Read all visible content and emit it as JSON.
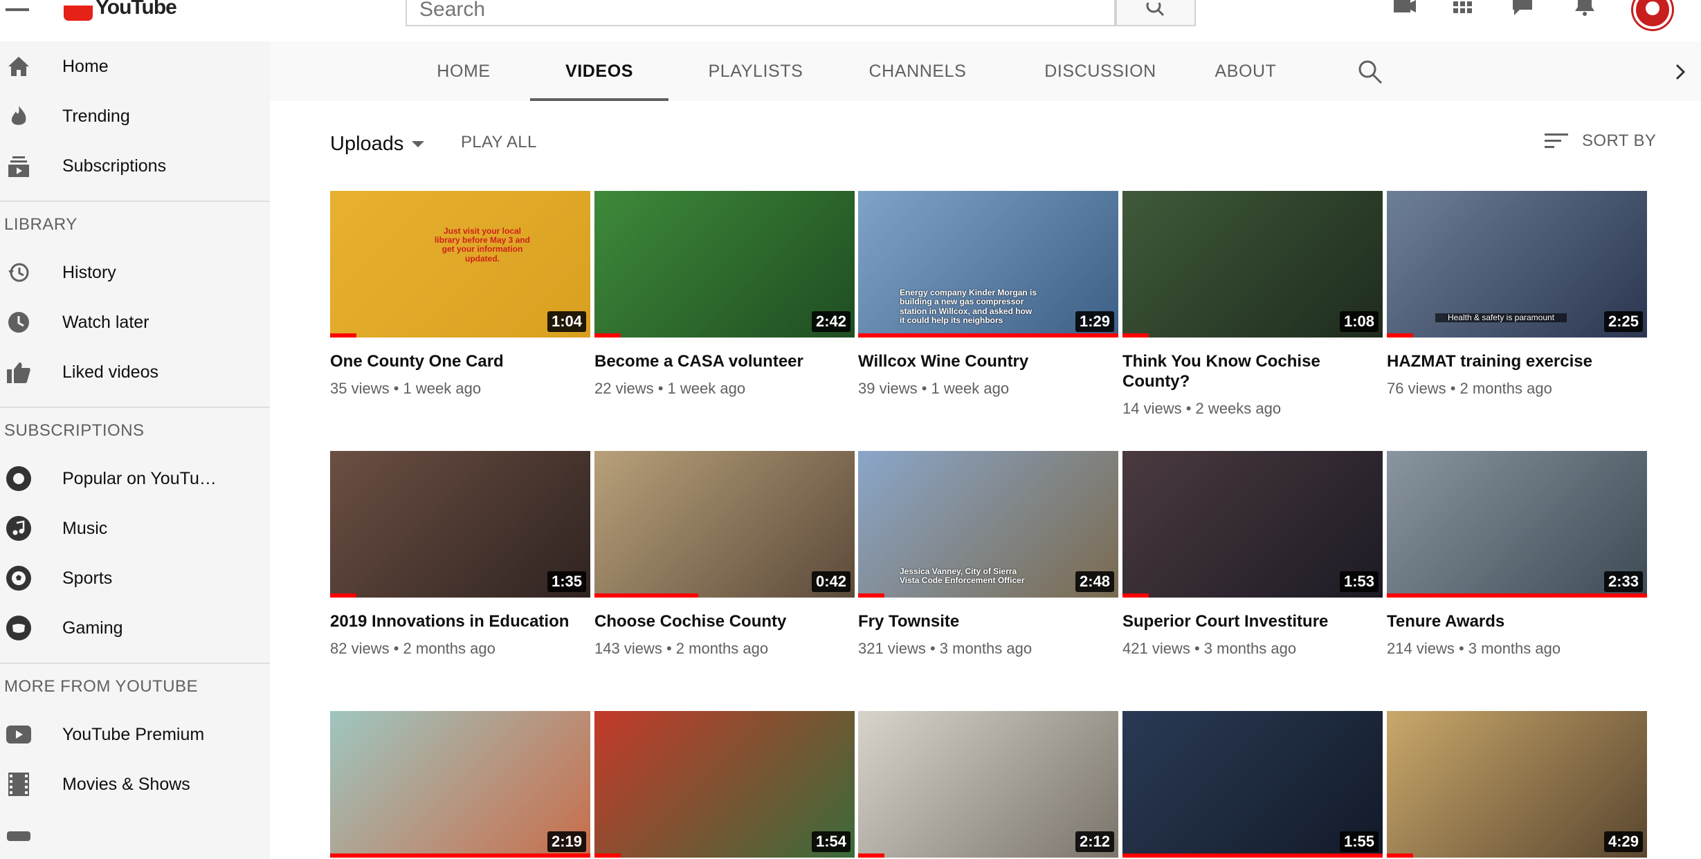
{
  "masthead": {
    "logo_text": "YouTube",
    "search_placeholder": "Search"
  },
  "sidebar": {
    "main_items": [
      {
        "label": "Home",
        "icon": "home-icon"
      },
      {
        "label": "Trending",
        "icon": "trending-icon"
      },
      {
        "label": "Subscriptions",
        "icon": "subscriptions-icon"
      }
    ],
    "library_heading": "LIBRARY",
    "library_items": [
      {
        "label": "History",
        "icon": "history-icon"
      },
      {
        "label": "Watch later",
        "icon": "watch-later-icon"
      },
      {
        "label": "Liked videos",
        "icon": "liked-videos-icon"
      }
    ],
    "subscriptions_heading": "SUBSCRIPTIONS",
    "subscription_items": [
      {
        "label": "Popular on YouTu…",
        "icon": "popular-channel-avatar"
      },
      {
        "label": "Music",
        "icon": "music-channel-avatar"
      },
      {
        "label": "Sports",
        "icon": "sports-channel-avatar"
      },
      {
        "label": "Gaming",
        "icon": "gaming-channel-avatar"
      }
    ],
    "more_heading": "MORE FROM YOUTUBE",
    "more_items": [
      {
        "label": "YouTube Premium",
        "icon": "youtube-premium-icon"
      },
      {
        "label": "Movies & Shows",
        "icon": "movies-icon"
      }
    ]
  },
  "tabs": [
    {
      "label": "HOME",
      "active": false
    },
    {
      "label": "VIDEOS",
      "active": true
    },
    {
      "label": "PLAYLISTS",
      "active": false
    },
    {
      "label": "CHANNELS",
      "active": false
    },
    {
      "label": "DISCUSSION",
      "active": false
    },
    {
      "label": "ABOUT",
      "active": false
    }
  ],
  "uploads": {
    "dropdown_label": "Uploads",
    "play_all_label": "PLAY ALL",
    "sort_label": "SORT BY"
  },
  "videos": [
    {
      "title": "One County One Card",
      "views": "35 views",
      "age": "1 week ago",
      "duration": "1:04",
      "watched_fraction": 0.1,
      "thumb_colors": [
        "#e7b12f",
        "#d9a020"
      ],
      "overlay": "Just visit your local library before May 3 and get your information updated."
    },
    {
      "title": "Become a CASA volunteer",
      "views": "22 views",
      "age": "1 week ago",
      "duration": "2:42",
      "watched_fraction": 0.1,
      "thumb_colors": [
        "#3e8a3a",
        "#1f4d22"
      ],
      "overlay": ""
    },
    {
      "title": "Willcox Wine Country",
      "views": "39 views",
      "age": "1 week ago",
      "duration": "1:29",
      "watched_fraction": 1.0,
      "thumb_colors": [
        "#7fa3c9",
        "#3d5f86"
      ],
      "overlay": "Energy company Kinder Morgan is building a new gas compressor station in Willcox, and asked how it could help its neighbors"
    },
    {
      "title": "Think You Know Cochise County?",
      "views": "14 views",
      "age": "2 weeks ago",
      "duration": "1:08",
      "watched_fraction": 0.1,
      "thumb_colors": [
        "#3f5a3a",
        "#1e2b1d"
      ],
      "overlay": ""
    },
    {
      "title": "HAZMAT training exercise",
      "views": "76 views",
      "age": "2 months ago",
      "duration": "2:25",
      "watched_fraction": 0.1,
      "thumb_colors": [
        "#6d7f96",
        "#2b3650"
      ],
      "overlay": "Health & safety is paramount"
    },
    {
      "title": "2019 Innovations in Education",
      "views": "82 views",
      "age": "2 months ago",
      "duration": "1:35",
      "watched_fraction": 0.1,
      "thumb_colors": [
        "#6b4f43",
        "#2f2320"
      ],
      "overlay": ""
    },
    {
      "title": "Choose Cochise County",
      "views": "143 views",
      "age": "2 months ago",
      "duration": "0:42",
      "watched_fraction": 0.4,
      "thumb_colors": [
        "#b8a07a",
        "#5c4a3a"
      ],
      "overlay": ""
    },
    {
      "title": "Fry Townsite",
      "views": "321 views",
      "age": "3 months ago",
      "duration": "2:48",
      "watched_fraction": 0.1,
      "thumb_colors": [
        "#8aa6c9",
        "#7a6a4f"
      ],
      "overlay": "Jessica Vanney, City of Sierra Vista Code Enforcement Officer"
    },
    {
      "title": "Superior Court Investiture",
      "views": "421 views",
      "age": "3 months ago",
      "duration": "1:53",
      "watched_fraction": 0.1,
      "thumb_colors": [
        "#4a3a40",
        "#1d1a24"
      ],
      "overlay": ""
    },
    {
      "title": "Tenure Awards",
      "views": "214 views",
      "age": "3 months ago",
      "duration": "2:33",
      "watched_fraction": 1.0,
      "thumb_colors": [
        "#8a95a0",
        "#3e4a55"
      ],
      "overlay": ""
    },
    {
      "title": "",
      "views": "",
      "age": "",
      "duration": "2:19",
      "watched_fraction": 1.0,
      "thumb_colors": [
        "#9fc6c0",
        "#c96d4a"
      ],
      "overlay": ""
    },
    {
      "title": "",
      "views": "",
      "age": "",
      "duration": "1:54",
      "watched_fraction": 0.1,
      "thumb_colors": [
        "#c43a2a",
        "#3a6b3a"
      ],
      "overlay": ""
    },
    {
      "title": "",
      "views": "",
      "age": "",
      "duration": "2:12",
      "watched_fraction": 0.1,
      "thumb_colors": [
        "#d8d4cc",
        "#7a746a"
      ],
      "overlay": ""
    },
    {
      "title": "",
      "views": "",
      "age": "",
      "duration": "1:55",
      "watched_fraction": 1.0,
      "thumb_colors": [
        "#2a3a55",
        "#121a28"
      ],
      "overlay": ""
    },
    {
      "title": "",
      "views": "",
      "age": "",
      "duration": "4:29",
      "watched_fraction": 0.1,
      "thumb_colors": [
        "#c9a86a",
        "#5a4630"
      ],
      "overlay": ""
    }
  ],
  "colors": {
    "accent_red": "#ff0000",
    "sidebar_bg": "#f5f5f5",
    "tabs_bg": "#f9f9f9",
    "secondary_text": "#606060"
  }
}
